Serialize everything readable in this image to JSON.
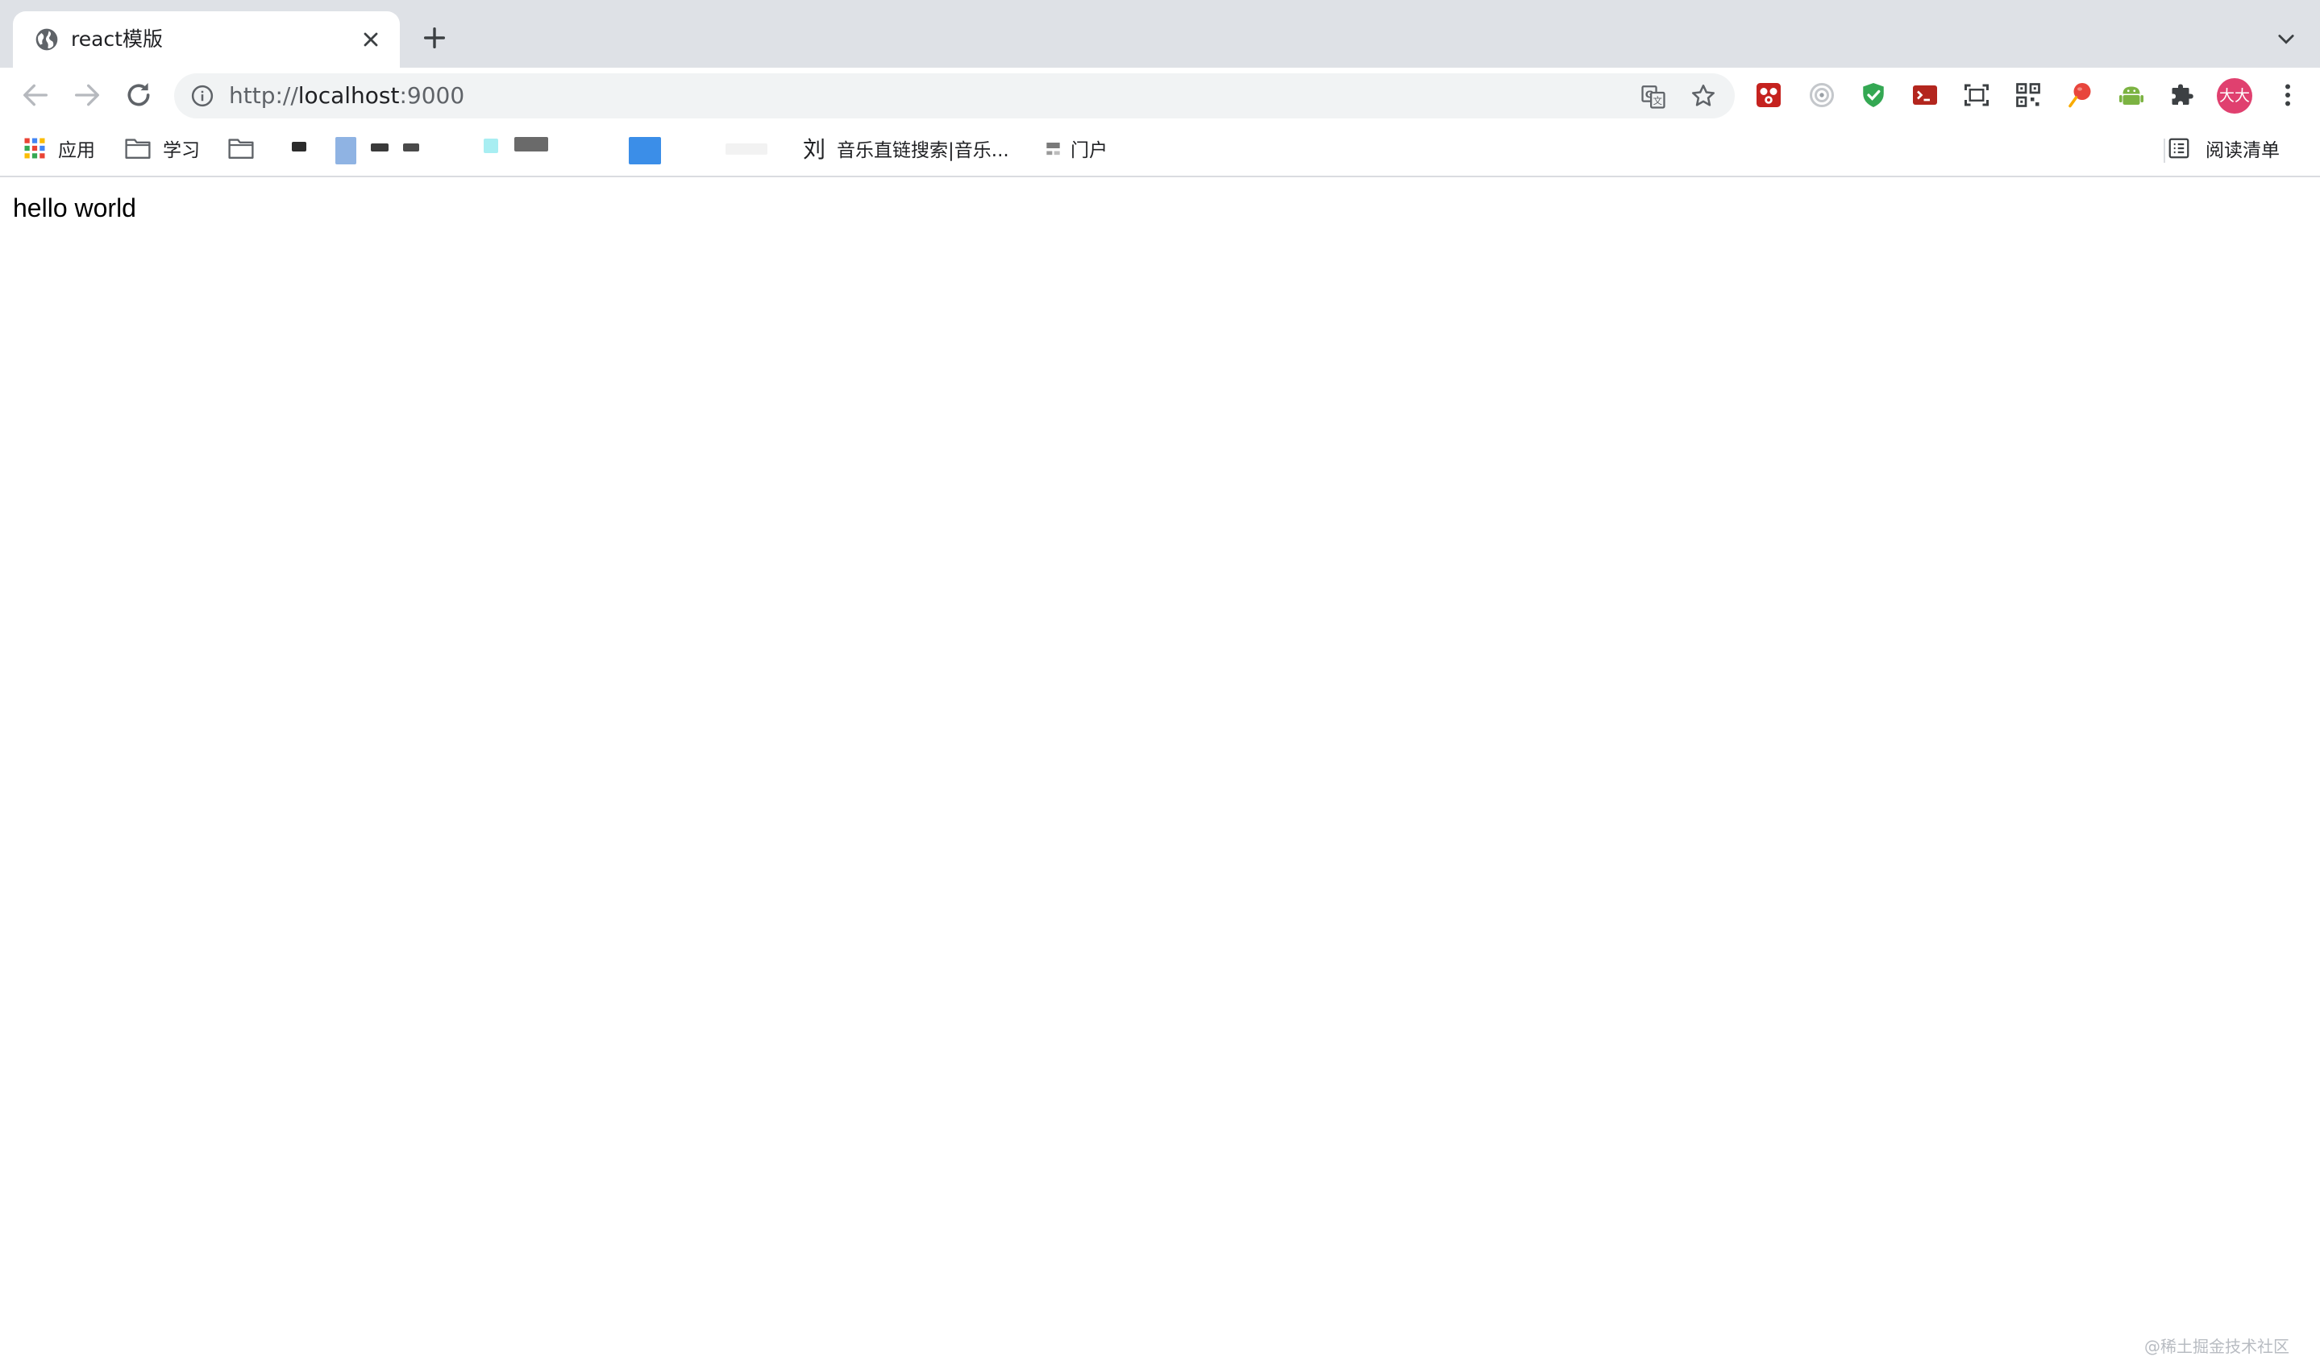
{
  "tab": {
    "title": "react模版"
  },
  "omnibox": {
    "url_scheme": "http://",
    "url_host": "localhost",
    "url_port": ":9000"
  },
  "profile": {
    "avatar_text": "大大"
  },
  "bookmarks": [
    {
      "label": "应用",
      "icon": "apps-grid-icon"
    },
    {
      "label": "学习",
      "icon": "folder-icon"
    },
    {
      "label": "",
      "icon": "folder-icon"
    },
    {
      "label": "音乐直链搜索|音乐...",
      "icon": "liu-icon",
      "icon_text": "刘"
    },
    {
      "label": "门户",
      "icon": "portal-icon"
    }
  ],
  "reading_list": {
    "label": "阅读清单"
  },
  "page": {
    "text": "hello world"
  },
  "watermark": "@稀土掘金技术社区",
  "colors": {
    "tabstrip": "#dee1e6",
    "omnibox": "#f1f3f4",
    "avatar": "#e0406f",
    "shield": "#34a853"
  },
  "extensions": [
    "puzzle-red-icon",
    "target-icon",
    "shield-check-icon",
    "terminal-icon",
    "screenshot-icon",
    "qr-code-icon",
    "balloon-icon",
    "android-icon",
    "extensions-puzzle-icon"
  ]
}
